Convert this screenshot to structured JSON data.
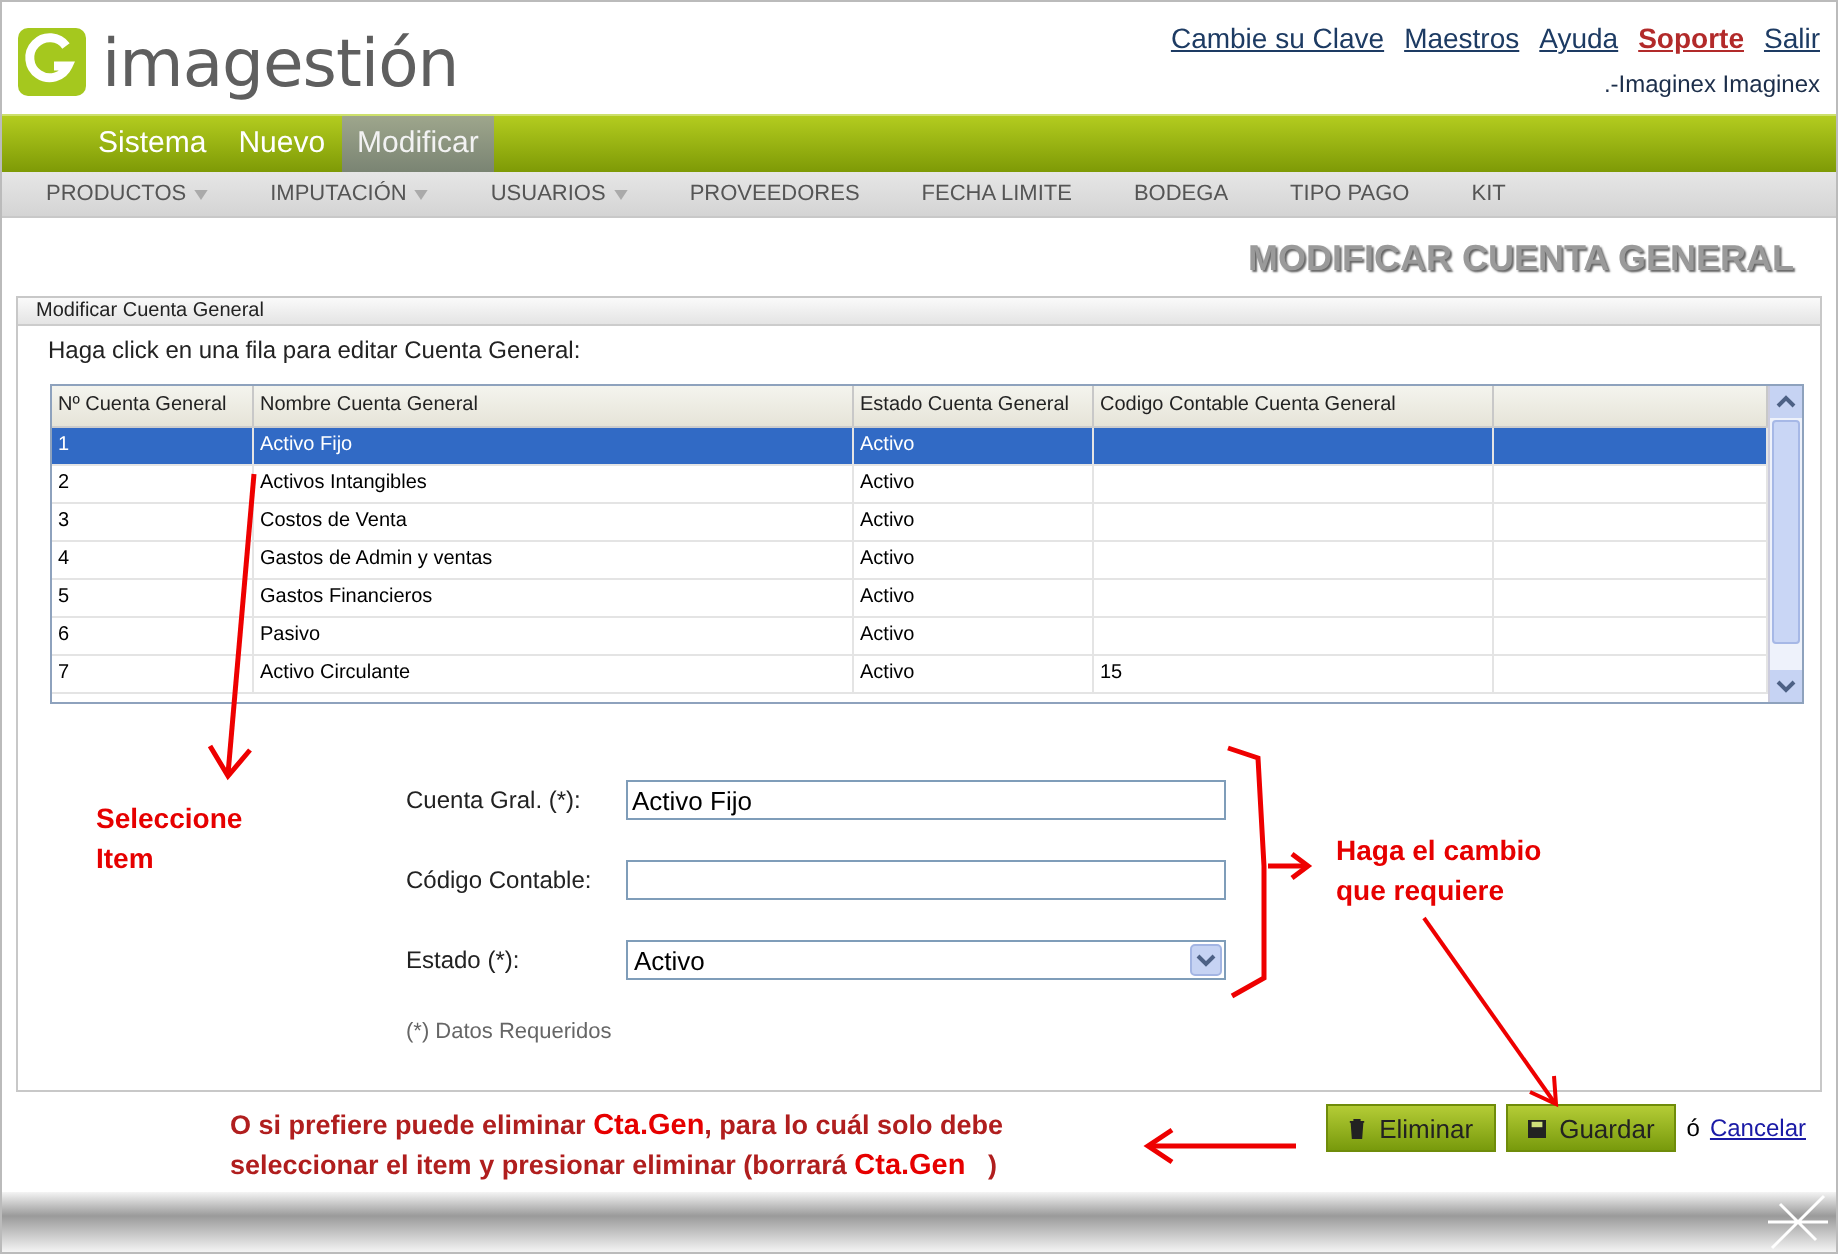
{
  "logo": {
    "text": "imagestión"
  },
  "top_links": [
    {
      "label": "Cambie su Clave",
      "kind": "normal"
    },
    {
      "label": "Maestros",
      "kind": "normal"
    },
    {
      "label": "Ayuda",
      "kind": "normal"
    },
    {
      "label": "Soporte",
      "kind": "highlight"
    },
    {
      "label": "Salir",
      "kind": "normal"
    }
  ],
  "user": ".-Imaginex Imaginex",
  "main_tabs": [
    {
      "label": "Sistema",
      "selected": false
    },
    {
      "label": "Nuevo",
      "selected": false
    },
    {
      "label": "Modificar",
      "selected": true
    }
  ],
  "sub_menu": [
    {
      "label": "PRODUCTOS",
      "dropdown": true
    },
    {
      "label": "IMPUTACIÓN",
      "dropdown": true
    },
    {
      "label": "USUARIOS",
      "dropdown": true
    },
    {
      "label": "PROVEEDORES",
      "dropdown": false
    },
    {
      "label": "FECHA LIMITE",
      "dropdown": false
    },
    {
      "label": "BODEGA",
      "dropdown": false
    },
    {
      "label": "TIPO PAGO",
      "dropdown": false
    },
    {
      "label": "KIT",
      "dropdown": false
    }
  ],
  "page_title": "MODIFICAR CUENTA GENERAL",
  "panel": {
    "title": "Modificar Cuenta General",
    "instruction": "Haga click en una fila para editar Cuenta General:"
  },
  "table": {
    "columns": [
      "Nº Cuenta General",
      "Nombre Cuenta General",
      "Estado Cuenta General",
      "Codigo Contable Cuenta General"
    ],
    "rows": [
      {
        "cells": [
          "1",
          "Activo Fijo",
          "Activo",
          ""
        ],
        "selected": true
      },
      {
        "cells": [
          "2",
          "Activos Intangibles",
          "Activo",
          ""
        ],
        "selected": false
      },
      {
        "cells": [
          "3",
          "Costos de Venta",
          "Activo",
          ""
        ],
        "selected": false
      },
      {
        "cells": [
          "4",
          "Gastos de Admin y ventas",
          "Activo",
          ""
        ],
        "selected": false
      },
      {
        "cells": [
          "5",
          "Gastos Financieros",
          "Activo",
          ""
        ],
        "selected": false
      },
      {
        "cells": [
          "6",
          "Pasivo",
          "Activo",
          ""
        ],
        "selected": false
      },
      {
        "cells": [
          "7",
          "Activo Circulante",
          "Activo",
          "15"
        ],
        "selected": false
      }
    ]
  },
  "form": {
    "fields": [
      {
        "label": "Cuenta Gral. (*):",
        "kind": "text",
        "value": "Activo Fijo"
      },
      {
        "label": "Código Contable:",
        "kind": "text"
      },
      {
        "label": "Estado (*):",
        "kind": "select",
        "value": "Activo"
      }
    ],
    "note": "(*) Datos Requeridos"
  },
  "buttons": [
    {
      "label": "Eliminar",
      "kind": "delete"
    },
    {
      "label": "Guardar",
      "kind": "save"
    }
  ],
  "or_text": "ó",
  "cancel_link": "Cancelar",
  "annotations": {
    "select_hint": "Seleccione\nItem",
    "change_hint": "Haga el cambio\nque requiere",
    "delete_hint": [
      [
        {
          "text": "O si prefiere puede eliminar ",
          "highlight": false
        },
        {
          "text": "Cta.Gen",
          "highlight": true
        },
        {
          "text": ", para lo cuál solo debe",
          "highlight": false
        }
      ],
      [
        {
          "text": "seleccionar el item y presionar eliminar (borrará ",
          "highlight": false
        },
        {
          "text": "Cta.Gen",
          "highlight": true
        },
        {
          "text": "   )",
          "highlight": false
        }
      ]
    ]
  }
}
